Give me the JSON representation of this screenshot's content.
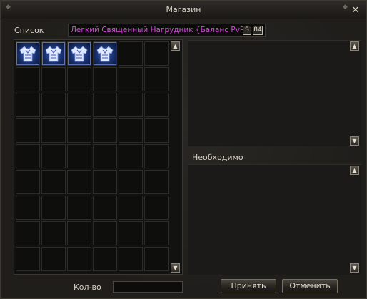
{
  "window": {
    "title": "Магазин",
    "close_symbol": "✕"
  },
  "list": {
    "label": "Список",
    "selected_item_name": "Легкий Священный Нагрудник {Баланс PvP}",
    "badge_grade": "S",
    "badge_level": "84",
    "item_icon": "blue-chest-armor-icon",
    "filled_slots": 4,
    "total_slots": 54
  },
  "required": {
    "label": "Необходимо"
  },
  "quantity": {
    "label": "Кол-во",
    "value": ""
  },
  "buttons": {
    "accept": "Принять",
    "cancel": "Отменить"
  },
  "scroll_icons": {
    "up": "▲",
    "down": "▼"
  },
  "colors": {
    "item_name": "#d04bd6",
    "frame_bg": "#1f1e1b",
    "slot_border": "#2e2c28"
  }
}
